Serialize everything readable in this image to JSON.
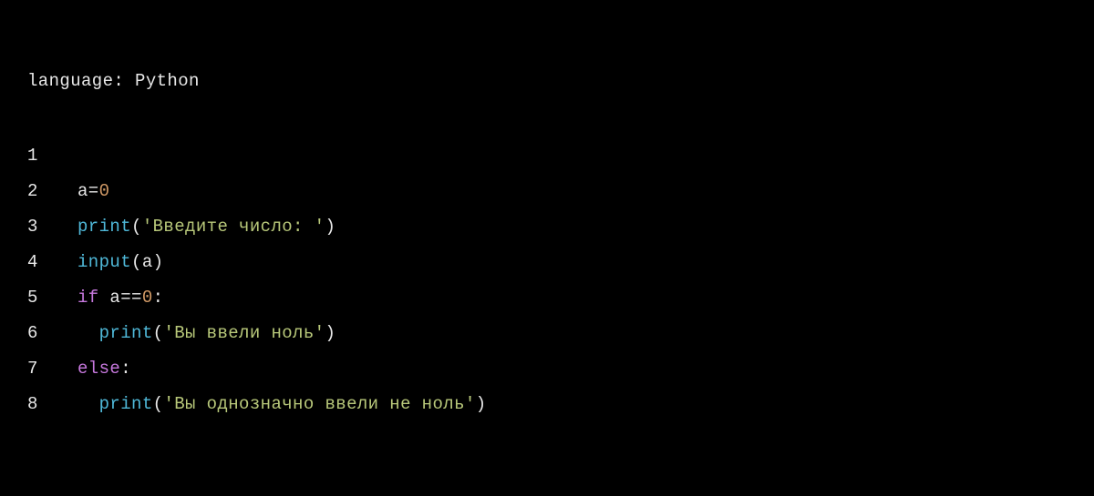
{
  "header": {
    "language_label": "language: ",
    "language_value": "Python"
  },
  "colors": {
    "background": "#000000",
    "default": "#e8e8e8",
    "number": "#d19a66",
    "builtin": "#4fb8d8",
    "string": "#b8c87a",
    "keyword": "#c678dd"
  },
  "code": {
    "lines": [
      {
        "num": "1",
        "tokens": []
      },
      {
        "num": "2",
        "tokens": [
          {
            "text": "a=",
            "cls": "tk-default"
          },
          {
            "text": "0",
            "cls": "tk-number"
          }
        ]
      },
      {
        "num": "3",
        "tokens": [
          {
            "text": "print",
            "cls": "tk-builtin"
          },
          {
            "text": "(",
            "cls": "tk-paren"
          },
          {
            "text": "'Введите число: '",
            "cls": "tk-string"
          },
          {
            "text": ")",
            "cls": "tk-paren"
          }
        ]
      },
      {
        "num": "4",
        "tokens": [
          {
            "text": "input",
            "cls": "tk-builtin"
          },
          {
            "text": "(a)",
            "cls": "tk-paren"
          }
        ]
      },
      {
        "num": "5",
        "tokens": [
          {
            "text": "if",
            "cls": "tk-keyword"
          },
          {
            "text": " a==",
            "cls": "tk-default"
          },
          {
            "text": "0",
            "cls": "tk-number"
          },
          {
            "text": ":",
            "cls": "tk-default"
          }
        ]
      },
      {
        "num": "6",
        "tokens": [
          {
            "text": "  ",
            "cls": "tk-default"
          },
          {
            "text": "print",
            "cls": "tk-builtin"
          },
          {
            "text": "(",
            "cls": "tk-paren"
          },
          {
            "text": "'Вы ввели ноль'",
            "cls": "tk-string"
          },
          {
            "text": ")",
            "cls": "tk-paren"
          }
        ]
      },
      {
        "num": "7",
        "tokens": [
          {
            "text": "else",
            "cls": "tk-keyword"
          },
          {
            "text": ":",
            "cls": "tk-default"
          }
        ]
      },
      {
        "num": "8",
        "tokens": [
          {
            "text": "  ",
            "cls": "tk-default"
          },
          {
            "text": "print",
            "cls": "tk-builtin"
          },
          {
            "text": "(",
            "cls": "tk-paren"
          },
          {
            "text": "'Вы однозначно ввели не ноль'",
            "cls": "tk-string"
          },
          {
            "text": ")",
            "cls": "tk-paren"
          }
        ]
      }
    ]
  }
}
